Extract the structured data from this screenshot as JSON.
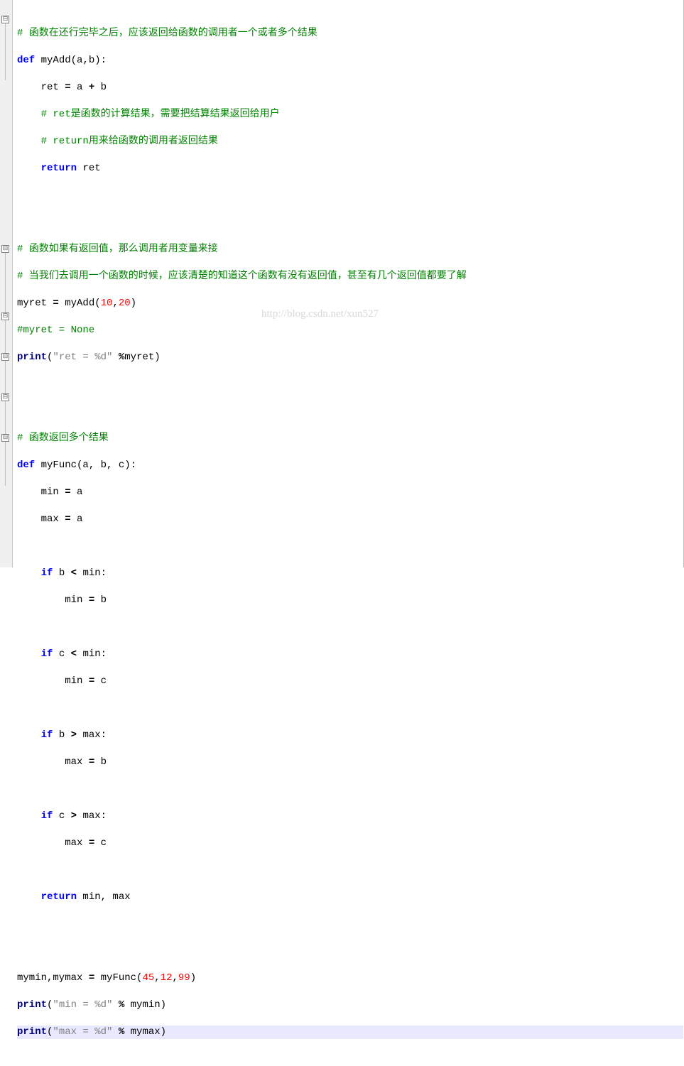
{
  "watermark": "http://blog.csdn.net/xun527",
  "fold_markers": [
    {
      "line": 1,
      "symbol": "⊟"
    },
    {
      "line": 17,
      "symbol": "⊟"
    },
    {
      "line": 22,
      "symbol": "⊟"
    },
    {
      "line": 25,
      "symbol": "⊟"
    },
    {
      "line": 28,
      "symbol": "⊟"
    },
    {
      "line": 31,
      "symbol": "⊟"
    }
  ],
  "code": {
    "l0_comment": "# 函数在还行完毕之后，应该返回给函数的调用者一个或者多个结果",
    "l1_def": "def",
    "l1_fname": " myAdd",
    "l1_params": "(a,b):",
    "l2_pre": "    ret ",
    "l2_op": "=",
    "l2_post": " a ",
    "l2_op2": "+",
    "l2_post2": " b",
    "l3_comment": "    # ret是函数的计算结果，需要把结算结果返回给用户",
    "l4_comment": "    # return用来给函数的调用者返回结果",
    "l5_kw": "    return",
    "l5_ret": " ret",
    "l8_comment": "# 函数如果有返回值，那么调用者用变量来接",
    "l9_comment": "# 当我们去调用一个函数的时候，应该清楚的知道这个函数有没有返回值，甚至有几个返回值都要了解",
    "l10_pre": "myret ",
    "l10_op": "=",
    "l10_call": " myAdd(",
    "l10_n1": "10",
    "l10_comma": ",",
    "l10_n2": "20",
    "l10_close": ")",
    "l11_comment": "#myret = None",
    "l12_print": "print",
    "l12_open": "(",
    "l12_str": "\"ret = %d\"",
    "l12_mod": " %",
    "l12_var": "myret)",
    "l15_comment": "# 函数返回多个结果",
    "l16_def": "def",
    "l16_fname": " myFunc",
    "l16_params": "(a, b, c):",
    "l17_pre": "    min ",
    "l17_op": "=",
    "l17_post": " a",
    "l18_pre": "    max ",
    "l18_op": "=",
    "l18_post": " a",
    "l20_if": "    if",
    "l20_cond": " b ",
    "l20_op": "<",
    "l20_post": " min:",
    "l21_pre": "        min ",
    "l21_op": "=",
    "l21_post": " b",
    "l23_if": "    if",
    "l23_cond": " c ",
    "l23_op": "<",
    "l23_post": " min:",
    "l24_pre": "        min ",
    "l24_op": "=",
    "l24_post": " c",
    "l26_if": "    if",
    "l26_cond": " b ",
    "l26_op": ">",
    "l26_post": " max:",
    "l27_pre": "        max ",
    "l27_op": "=",
    "l27_post": " b",
    "l29_if": "    if",
    "l29_cond": " c ",
    "l29_op": ">",
    "l29_post": " max:",
    "l30_pre": "        max ",
    "l30_op": "=",
    "l30_post": " c",
    "l32_kw": "    return",
    "l32_ret": " min, max",
    "l35_pre": "mymin,mymax ",
    "l35_op": "=",
    "l35_call": " myFunc(",
    "l35_n1": "45",
    "l35_c1": ",",
    "l35_n2": "12",
    "l35_c2": ",",
    "l35_n3": "99",
    "l35_close": ")",
    "l36_print": "print",
    "l36_open": "(",
    "l36_str": "\"min = %d\"",
    "l36_mod": " % ",
    "l36_var": "mymin)",
    "l37_print": "print",
    "l37_open": "(",
    "l37_str": "\"max = %d\"",
    "l37_mod": " % ",
    "l37_var": "mymax)"
  }
}
